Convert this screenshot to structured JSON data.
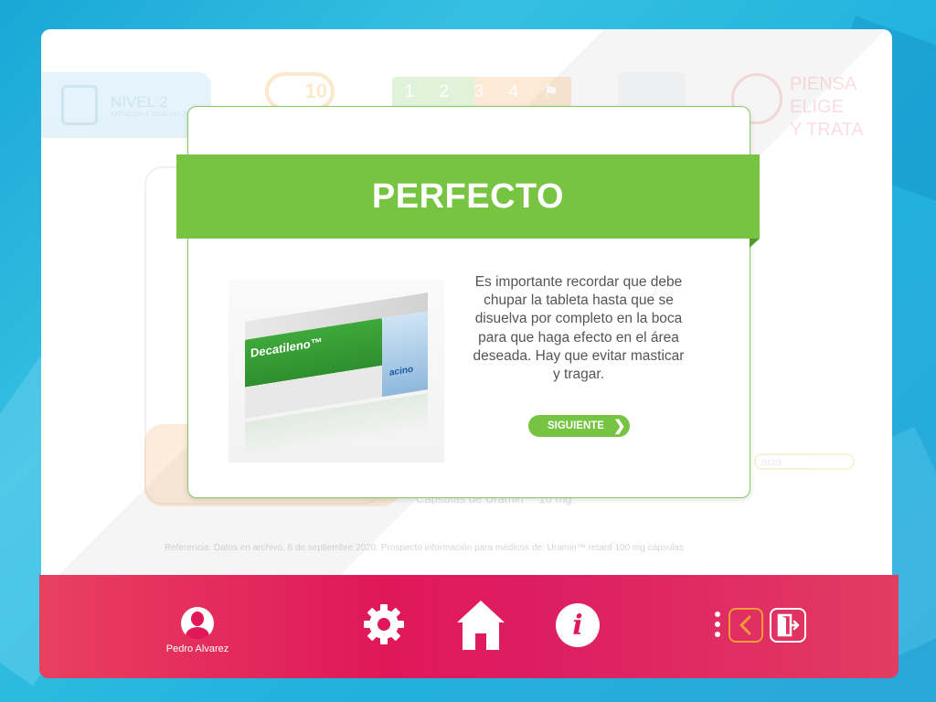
{
  "background_header": {
    "level_title": "NIVEL 2",
    "level_subtitle": "ATENCIÓN A TODA VELOCIDAD",
    "timer_value": "10",
    "steps": [
      "1",
      "2",
      "3",
      "4"
    ],
    "tagline": [
      "PIENSA",
      "ELIGE",
      "Y TRATA"
    ]
  },
  "background_content": {
    "capsule_text": "Cápsulas de Uramin™ 10 mg",
    "partial_label": "acia",
    "reference": "Referencia: Datos en archivo, 6 de septiembre 2020. Prospecto información para médicos de: Uramin™ retard 100 mg cápsulas"
  },
  "modal": {
    "title": "PERFECTO",
    "product_name": "Decatileno™",
    "product_brand": "acino",
    "message": "Es importante recordar que debe chupar la tableta hasta que se disuelva por completo en la boca para que haga efecto en el área deseada. Hay que evitar masticar y tragar.",
    "next_label": "SIGUIENTE"
  },
  "footer": {
    "user_name": "Pedro Alvarez"
  },
  "colors": {
    "accent_green": "#76c442",
    "footer_pink": "#e0185a",
    "back_orange": "#f39a3a"
  },
  "icons": [
    "user-avatar-icon",
    "gear-icon",
    "home-icon",
    "info-icon",
    "more-dots-icon",
    "back-chevron-icon",
    "exit-door-icon"
  ]
}
